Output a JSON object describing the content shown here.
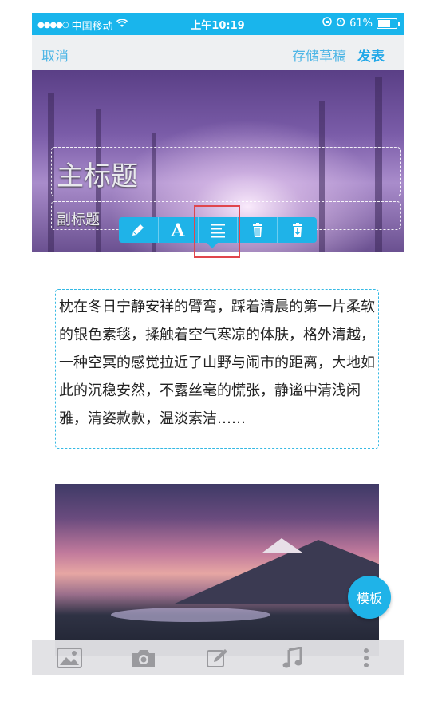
{
  "status_bar": {
    "carrier": "中国移动",
    "time": "上午10:19",
    "battery": "61%",
    "battery_level": 0.61,
    "signal_dots": "●●●●○"
  },
  "nav": {
    "cancel": "取消",
    "save_draft": "存储草稿",
    "publish": "发表"
  },
  "cover": {
    "title": "主标题",
    "subtitle": "副标题"
  },
  "edit_toolbar": {
    "tools": [
      "pencil-icon",
      "font-icon",
      "align-icon",
      "trash-icon",
      "trash-download-icon"
    ],
    "selected": "align-icon"
  },
  "article": {
    "text": "枕在冬日宁静安祥的臂弯，踩着清晨的第一片柔软的银色素毯，揉触着空气寒凉的体肤，格外清越，一种空冥的感觉拉近了山野与闹市的距离，大地如此的沉稳安然，不露丝毫的慌张，静谧中清浅闲雅，清姿款款，温淡素洁……"
  },
  "fab": {
    "label": "模板"
  },
  "bottom_bar": {
    "items": [
      "image-icon",
      "camera-icon",
      "edit-icon",
      "music-icon",
      "more-icon"
    ]
  },
  "colors": {
    "accent": "#1fb3e8",
    "highlight": "#e0464c",
    "nav_text": "#4fb6e6"
  }
}
